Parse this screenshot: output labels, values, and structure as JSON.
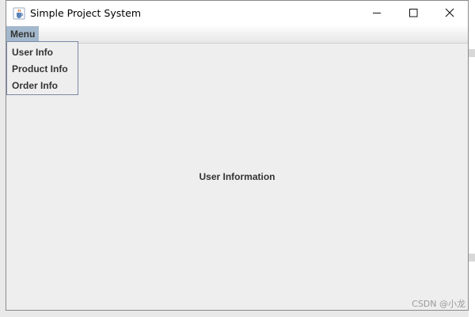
{
  "window": {
    "title": "Simple Project System"
  },
  "menubar": {
    "menu_label": "Menu"
  },
  "menu_items": [
    {
      "label": "User Info"
    },
    {
      "label": "Product Info"
    },
    {
      "label": "Order Info"
    }
  ],
  "content": {
    "label": "User Information"
  },
  "watermark": "CSDN @小龙",
  "colors": {
    "menu_highlight": "#a3b8cc",
    "popup_border": "#7a8aa8",
    "panel_bg": "#eeeeee"
  },
  "icons": {
    "app": "java-cup-icon",
    "minimize": "minimize-icon",
    "maximize": "maximize-icon",
    "close": "close-icon"
  }
}
